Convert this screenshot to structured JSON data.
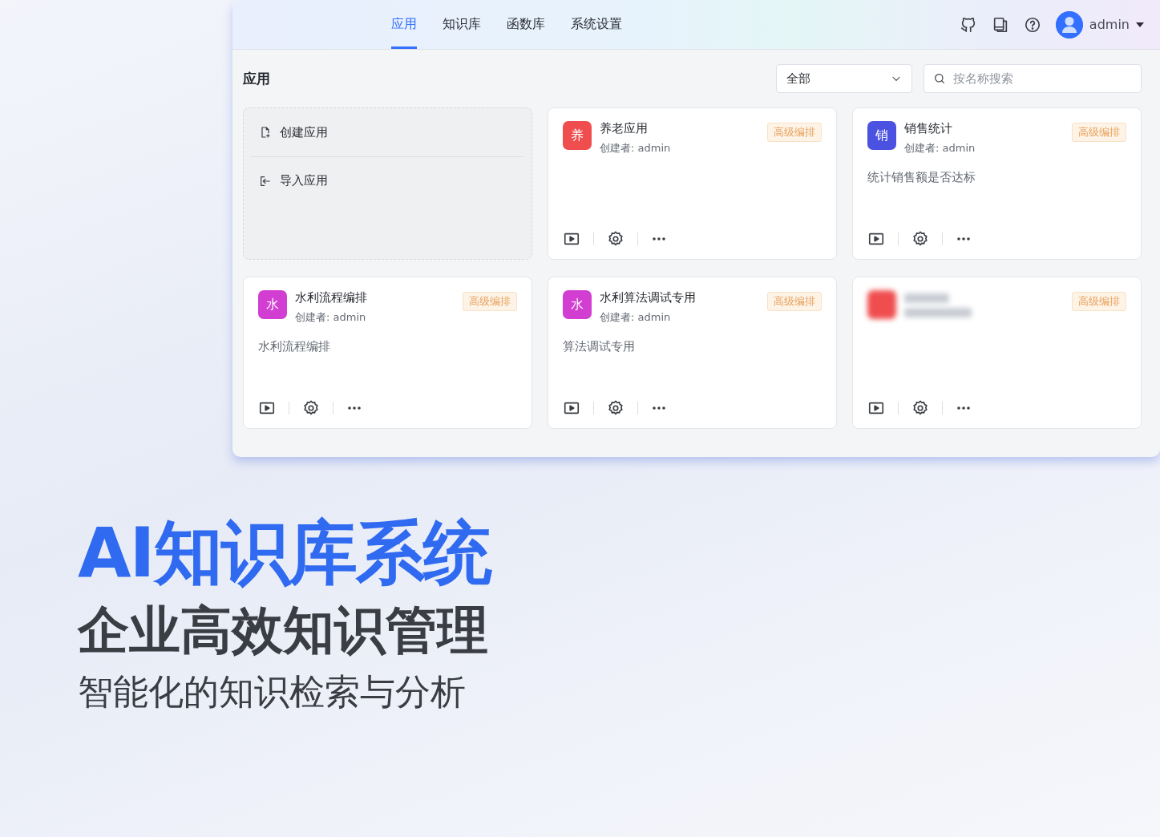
{
  "nav": {
    "tabs": [
      {
        "label": "应用",
        "selected": true
      },
      {
        "label": "知识库",
        "selected": false
      },
      {
        "label": "函数库",
        "selected": false
      },
      {
        "label": "系统设置",
        "selected": false
      }
    ],
    "user": "admin"
  },
  "page_title": "应用",
  "filter": {
    "value": "全部"
  },
  "search": {
    "placeholder": "按名称搜索"
  },
  "create_panel": {
    "actions": [
      {
        "kind": "create",
        "label": "创建应用"
      },
      {
        "kind": "import",
        "label": "导入应用"
      }
    ]
  },
  "cards": [
    {
      "kind": "app",
      "initial": "养",
      "color": "#f04e4e",
      "name": "养老应用",
      "creator": "创建者: admin",
      "tag": "高级编排"
    },
    {
      "kind": "app",
      "initial": "销",
      "color": "#4b51e0",
      "name": "销售统计",
      "creator": "创建者: admin",
      "tag": "高级编排",
      "description": "统计销售额是否达标"
    },
    {
      "kind": "app",
      "initial": "水",
      "color": "#d23ed2",
      "name": "水利流程编排",
      "creator": "创建者: admin",
      "tag": "高级编排",
      "description": "水利流程编排"
    },
    {
      "kind": "app",
      "initial": "水",
      "color": "#d23ed2",
      "name": "水利算法调试专用",
      "creator": "创建者: admin",
      "tag": "高级编排",
      "description": "算法调试专用"
    },
    {
      "kind": "blurred",
      "color": "#f04e4e",
      "tag": "高级编排"
    }
  ],
  "headline": {
    "title": "AI知识库系统",
    "subtitle": "企业高效知识管理",
    "tagline": "智能化的知识检索与分析"
  }
}
